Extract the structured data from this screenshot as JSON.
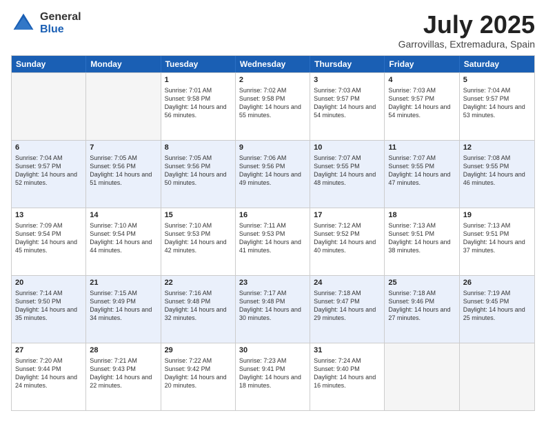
{
  "logo": {
    "general": "General",
    "blue": "Blue"
  },
  "title": "July 2025",
  "location": "Garrovillas, Extremadura, Spain",
  "weekdays": [
    "Sunday",
    "Monday",
    "Tuesday",
    "Wednesday",
    "Thursday",
    "Friday",
    "Saturday"
  ],
  "rows": [
    [
      {
        "day": "",
        "sunrise": "",
        "sunset": "",
        "daylight": ""
      },
      {
        "day": "",
        "sunrise": "",
        "sunset": "",
        "daylight": ""
      },
      {
        "day": "1",
        "sunrise": "Sunrise: 7:01 AM",
        "sunset": "Sunset: 9:58 PM",
        "daylight": "Daylight: 14 hours and 56 minutes."
      },
      {
        "day": "2",
        "sunrise": "Sunrise: 7:02 AM",
        "sunset": "Sunset: 9:58 PM",
        "daylight": "Daylight: 14 hours and 55 minutes."
      },
      {
        "day": "3",
        "sunrise": "Sunrise: 7:03 AM",
        "sunset": "Sunset: 9:57 PM",
        "daylight": "Daylight: 14 hours and 54 minutes."
      },
      {
        "day": "4",
        "sunrise": "Sunrise: 7:03 AM",
        "sunset": "Sunset: 9:57 PM",
        "daylight": "Daylight: 14 hours and 54 minutes."
      },
      {
        "day": "5",
        "sunrise": "Sunrise: 7:04 AM",
        "sunset": "Sunset: 9:57 PM",
        "daylight": "Daylight: 14 hours and 53 minutes."
      }
    ],
    [
      {
        "day": "6",
        "sunrise": "Sunrise: 7:04 AM",
        "sunset": "Sunset: 9:57 PM",
        "daylight": "Daylight: 14 hours and 52 minutes."
      },
      {
        "day": "7",
        "sunrise": "Sunrise: 7:05 AM",
        "sunset": "Sunset: 9:56 PM",
        "daylight": "Daylight: 14 hours and 51 minutes."
      },
      {
        "day": "8",
        "sunrise": "Sunrise: 7:05 AM",
        "sunset": "Sunset: 9:56 PM",
        "daylight": "Daylight: 14 hours and 50 minutes."
      },
      {
        "day": "9",
        "sunrise": "Sunrise: 7:06 AM",
        "sunset": "Sunset: 9:56 PM",
        "daylight": "Daylight: 14 hours and 49 minutes."
      },
      {
        "day": "10",
        "sunrise": "Sunrise: 7:07 AM",
        "sunset": "Sunset: 9:55 PM",
        "daylight": "Daylight: 14 hours and 48 minutes."
      },
      {
        "day": "11",
        "sunrise": "Sunrise: 7:07 AM",
        "sunset": "Sunset: 9:55 PM",
        "daylight": "Daylight: 14 hours and 47 minutes."
      },
      {
        "day": "12",
        "sunrise": "Sunrise: 7:08 AM",
        "sunset": "Sunset: 9:55 PM",
        "daylight": "Daylight: 14 hours and 46 minutes."
      }
    ],
    [
      {
        "day": "13",
        "sunrise": "Sunrise: 7:09 AM",
        "sunset": "Sunset: 9:54 PM",
        "daylight": "Daylight: 14 hours and 45 minutes."
      },
      {
        "day": "14",
        "sunrise": "Sunrise: 7:10 AM",
        "sunset": "Sunset: 9:54 PM",
        "daylight": "Daylight: 14 hours and 44 minutes."
      },
      {
        "day": "15",
        "sunrise": "Sunrise: 7:10 AM",
        "sunset": "Sunset: 9:53 PM",
        "daylight": "Daylight: 14 hours and 42 minutes."
      },
      {
        "day": "16",
        "sunrise": "Sunrise: 7:11 AM",
        "sunset": "Sunset: 9:53 PM",
        "daylight": "Daylight: 14 hours and 41 minutes."
      },
      {
        "day": "17",
        "sunrise": "Sunrise: 7:12 AM",
        "sunset": "Sunset: 9:52 PM",
        "daylight": "Daylight: 14 hours and 40 minutes."
      },
      {
        "day": "18",
        "sunrise": "Sunrise: 7:13 AM",
        "sunset": "Sunset: 9:51 PM",
        "daylight": "Daylight: 14 hours and 38 minutes."
      },
      {
        "day": "19",
        "sunrise": "Sunrise: 7:13 AM",
        "sunset": "Sunset: 9:51 PM",
        "daylight": "Daylight: 14 hours and 37 minutes."
      }
    ],
    [
      {
        "day": "20",
        "sunrise": "Sunrise: 7:14 AM",
        "sunset": "Sunset: 9:50 PM",
        "daylight": "Daylight: 14 hours and 35 minutes."
      },
      {
        "day": "21",
        "sunrise": "Sunrise: 7:15 AM",
        "sunset": "Sunset: 9:49 PM",
        "daylight": "Daylight: 14 hours and 34 minutes."
      },
      {
        "day": "22",
        "sunrise": "Sunrise: 7:16 AM",
        "sunset": "Sunset: 9:48 PM",
        "daylight": "Daylight: 14 hours and 32 minutes."
      },
      {
        "day": "23",
        "sunrise": "Sunrise: 7:17 AM",
        "sunset": "Sunset: 9:48 PM",
        "daylight": "Daylight: 14 hours and 30 minutes."
      },
      {
        "day": "24",
        "sunrise": "Sunrise: 7:18 AM",
        "sunset": "Sunset: 9:47 PM",
        "daylight": "Daylight: 14 hours and 29 minutes."
      },
      {
        "day": "25",
        "sunrise": "Sunrise: 7:18 AM",
        "sunset": "Sunset: 9:46 PM",
        "daylight": "Daylight: 14 hours and 27 minutes."
      },
      {
        "day": "26",
        "sunrise": "Sunrise: 7:19 AM",
        "sunset": "Sunset: 9:45 PM",
        "daylight": "Daylight: 14 hours and 25 minutes."
      }
    ],
    [
      {
        "day": "27",
        "sunrise": "Sunrise: 7:20 AM",
        "sunset": "Sunset: 9:44 PM",
        "daylight": "Daylight: 14 hours and 24 minutes."
      },
      {
        "day": "28",
        "sunrise": "Sunrise: 7:21 AM",
        "sunset": "Sunset: 9:43 PM",
        "daylight": "Daylight: 14 hours and 22 minutes."
      },
      {
        "day": "29",
        "sunrise": "Sunrise: 7:22 AM",
        "sunset": "Sunset: 9:42 PM",
        "daylight": "Daylight: 14 hours and 20 minutes."
      },
      {
        "day": "30",
        "sunrise": "Sunrise: 7:23 AM",
        "sunset": "Sunset: 9:41 PM",
        "daylight": "Daylight: 14 hours and 18 minutes."
      },
      {
        "day": "31",
        "sunrise": "Sunrise: 7:24 AM",
        "sunset": "Sunset: 9:40 PM",
        "daylight": "Daylight: 14 hours and 16 minutes."
      },
      {
        "day": "",
        "sunrise": "",
        "sunset": "",
        "daylight": ""
      },
      {
        "day": "",
        "sunrise": "",
        "sunset": "",
        "daylight": ""
      }
    ]
  ]
}
